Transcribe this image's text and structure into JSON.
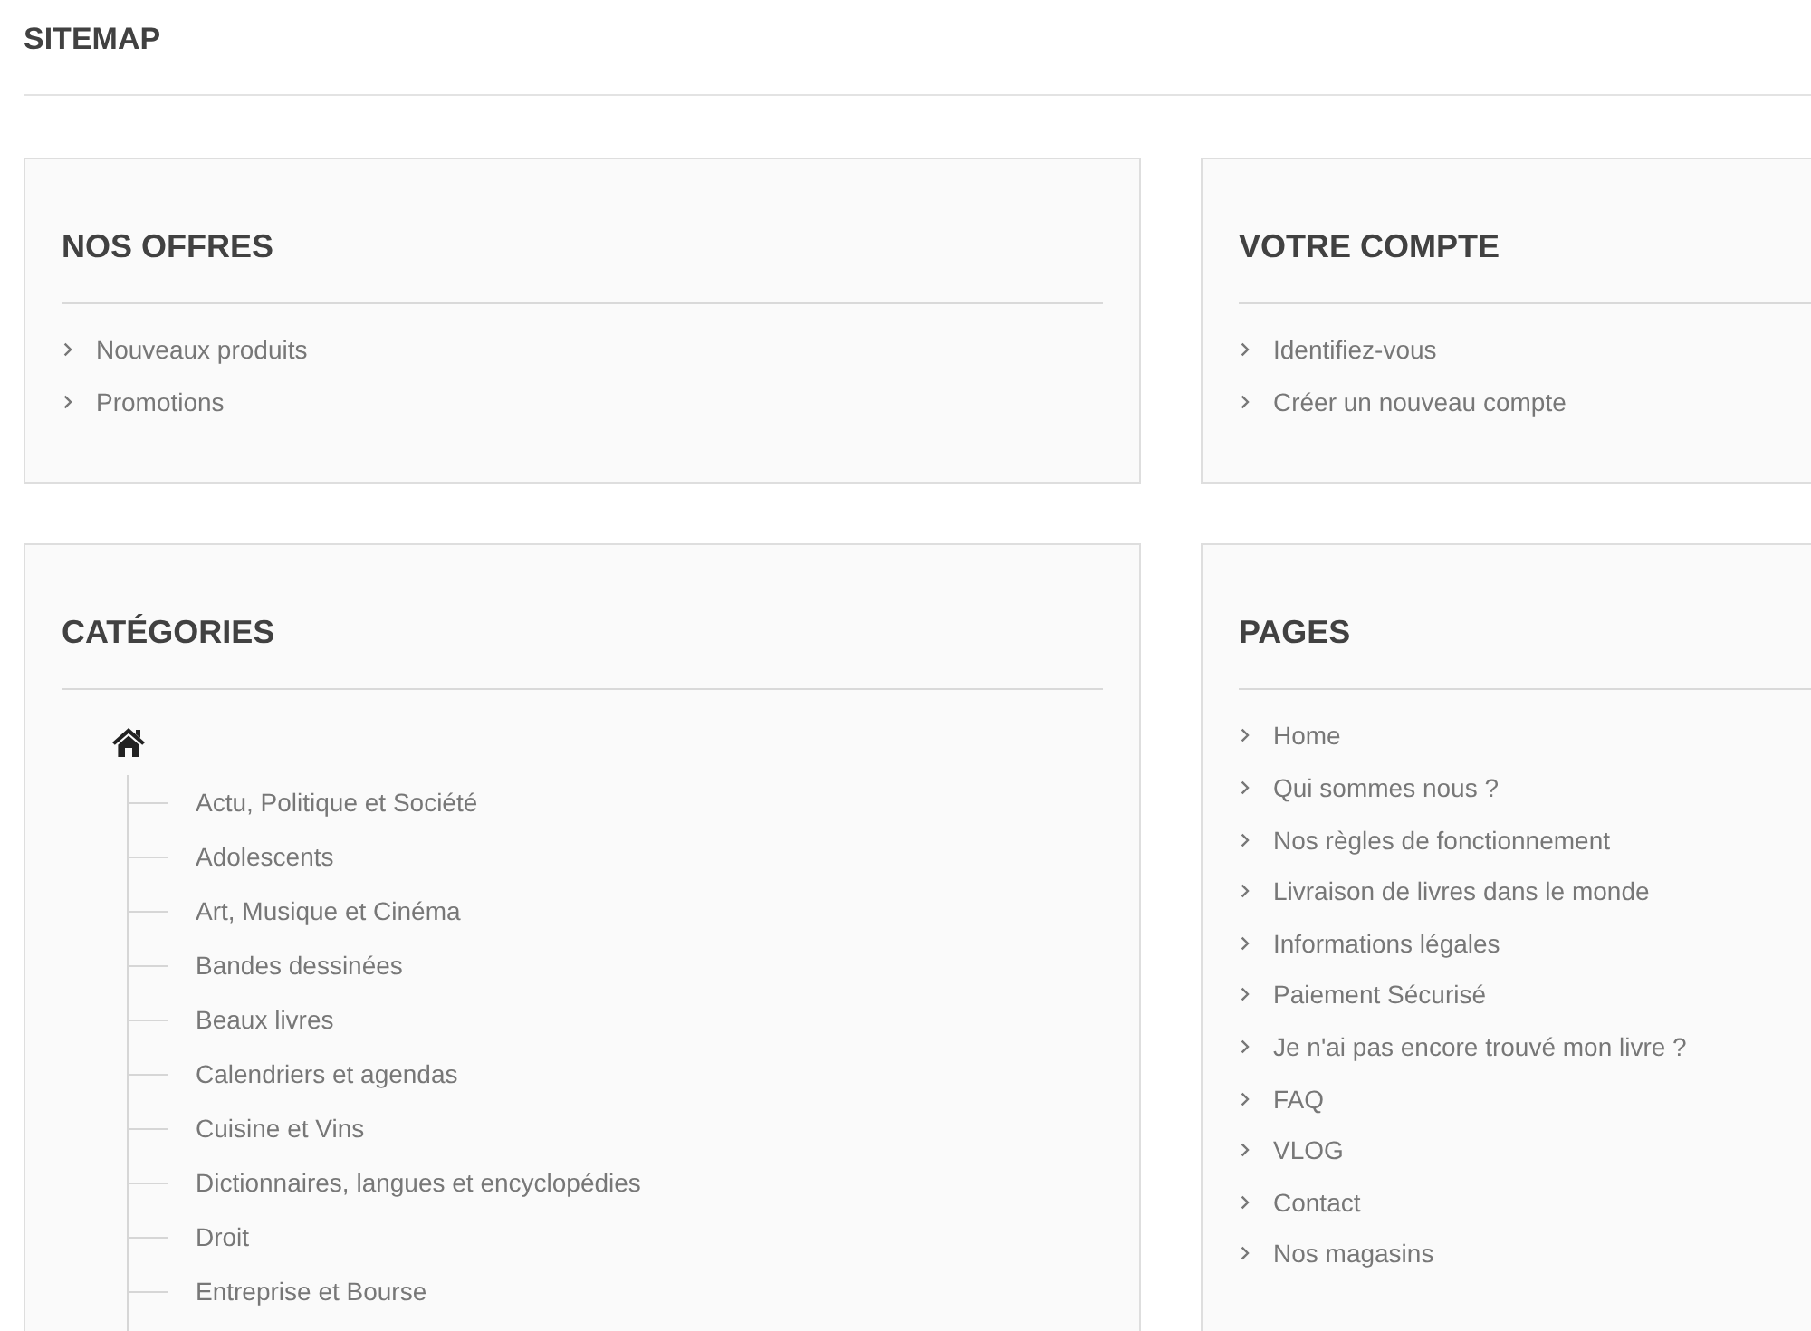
{
  "page_title": "SITEMAP",
  "sections": [
    {
      "title": "NOS OFFRES",
      "kind": "links",
      "items": [
        "Nouveaux produits",
        "Promotions"
      ]
    },
    {
      "title": "VOTRE COMPTE",
      "kind": "links",
      "items": [
        "Identifiez-vous",
        "Créer un nouveau compte"
      ]
    },
    {
      "title": "CATÉGORIES",
      "kind": "tree",
      "tree": [
        {
          "kind": "home",
          "children": [
            {
              "label": "Actu, Politique et Société"
            },
            {
              "label": "Adolescents"
            },
            {
              "label": "Art, Musique et Cinéma"
            },
            {
              "label": "Bandes dessinées"
            },
            {
              "label": "Beaux livres"
            },
            {
              "label": "Calendriers et agendas"
            },
            {
              "label": "Cuisine et Vins"
            },
            {
              "label": "Dictionnaires, langues et encyclopédies"
            },
            {
              "label": "Droit"
            },
            {
              "label": "Entreprise et Bourse"
            }
          ]
        }
      ]
    },
    {
      "title": "PAGES",
      "kind": "links",
      "items": [
        "Home",
        "Qui sommes nous ?",
        "Nos règles de fonctionnement",
        "Livraison de livres dans le monde",
        "Informations légales",
        "Paiement Sécurisé",
        "Je n'ai pas encore trouvé mon livre ?",
        "FAQ",
        "VLOG",
        "Contact",
        "Nos magasins"
      ]
    }
  ]
}
